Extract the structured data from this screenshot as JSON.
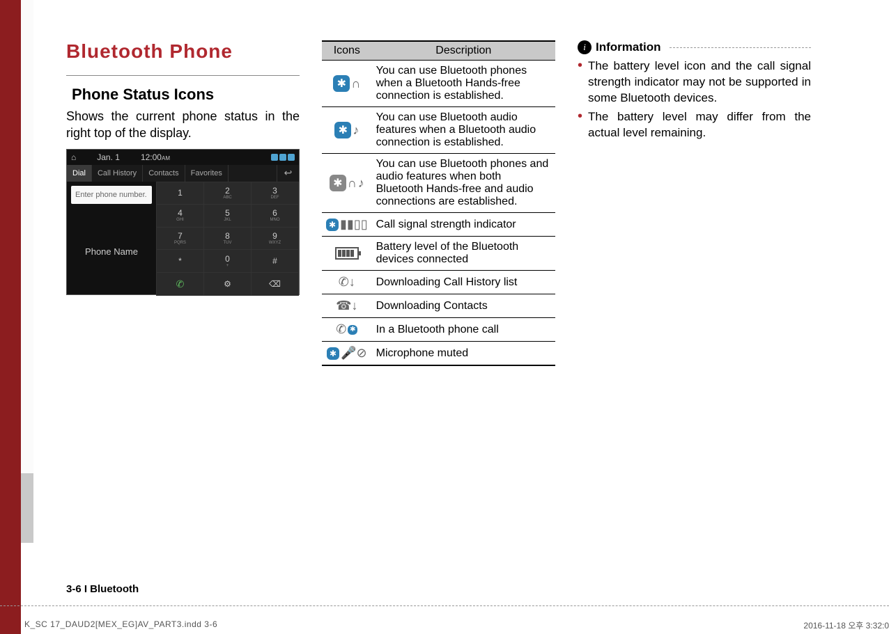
{
  "title": "Bluetooth Phone",
  "subhead": "Phone Status Icons",
  "intro": "Shows the current phone status in the right top of the display.",
  "shot": {
    "date": "Jan. 1",
    "time": "12:00",
    "ampm": "AM",
    "tabs": {
      "dial": "Dial",
      "history": "Call History",
      "contacts": "Contacts",
      "fav": "Favorites"
    },
    "placeholder": "Enter phone number.",
    "phonename": "Phone Name",
    "keys": [
      {
        "n": "1",
        "s": ""
      },
      {
        "n": "2",
        "s": "ABC"
      },
      {
        "n": "3",
        "s": "DEF"
      },
      {
        "n": "4",
        "s": "GHI"
      },
      {
        "n": "5",
        "s": "JKL"
      },
      {
        "n": "6",
        "s": "MNO"
      },
      {
        "n": "7",
        "s": "PQRS"
      },
      {
        "n": "8",
        "s": "TUV"
      },
      {
        "n": "9",
        "s": "WXYZ"
      },
      {
        "n": "*",
        "s": ""
      },
      {
        "n": "0",
        "s": "+"
      },
      {
        "n": "#",
        "s": ""
      }
    ]
  },
  "table": {
    "head_icons": "Icons",
    "head_desc": "Description",
    "rows": [
      {
        "icon": "bt_headset",
        "desc": "You can use Bluetooth phones when a Bluetooth Hands-free connection is established."
      },
      {
        "icon": "bt_music",
        "desc": "You can use Bluetooth audio features when a Bluetooth audio connection is established."
      },
      {
        "icon": "bt_both",
        "desc": "You can use Bluetooth phones and audio features when both Bluetooth Hands-free and audio connections are established."
      },
      {
        "icon": "bt_signal",
        "desc": "Call signal strength indicator"
      },
      {
        "icon": "battery",
        "desc": "Battery level of the Bluetooth devices connected"
      },
      {
        "icon": "dl_history",
        "desc": "Downloading Call History list"
      },
      {
        "icon": "dl_contacts",
        "desc": "Downloading Contacts"
      },
      {
        "icon": "in_call",
        "desc": "In a Bluetooth phone call"
      },
      {
        "icon": "mic_mute",
        "desc": "Microphone muted"
      }
    ]
  },
  "info": {
    "label": "Information",
    "bullets": [
      "The battery level icon and the call signal strength indicator may not be supported in some Bluetooth devices.",
      "The battery level may differ from the actual level remaining."
    ]
  },
  "footer": "3-6 I Bluetooth",
  "indd_file": "K_SC 17_DAUD2[MEX_EG]AV_PART3.indd   3-6",
  "indd_date": "2016-11-18   오후 3:32:0"
}
